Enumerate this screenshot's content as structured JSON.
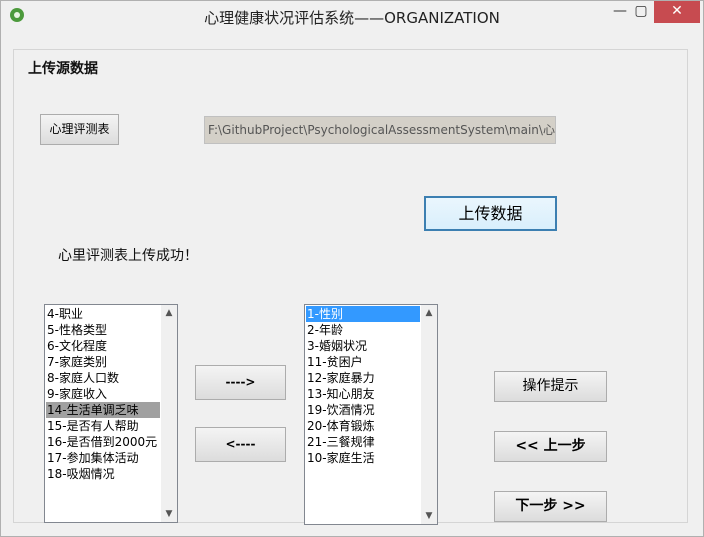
{
  "window": {
    "title": "心理健康状况评估系统——ORGANIZATION",
    "minimize_glyph": "—",
    "maximize_glyph": "▢",
    "close_glyph": "✕",
    "icon": "app-icon"
  },
  "group": {
    "title": "上传源数据"
  },
  "buttons": {
    "scale": "心理评测表",
    "upload": "上传数据",
    "move_right": "---->",
    "move_left": "<----",
    "hint": "操作提示",
    "prev": "<< 上一步",
    "next": "下一步 >>"
  },
  "path_field": {
    "value": "F:\\GithubProject\\PsychologicalAssessmentSystem\\main\\心理"
  },
  "status": {
    "message": "心里评测表上传成功！"
  },
  "left_list": {
    "items": [
      "4-职业",
      "5-性格类型",
      "6-文化程度",
      "7-家庭类别",
      "8-家庭人口数",
      "9-家庭收入",
      "14-生活单调乏味",
      "15-是否有人帮助",
      "16-是否借到2000元",
      "17-参加集体活动",
      "18-吸烟情况"
    ],
    "selected": "14-生活单调乏味"
  },
  "right_list": {
    "items": [
      "1-性别",
      "2-年龄",
      "3-婚姻状况",
      "11-贫困户",
      "12-家庭暴力",
      "13-知心朋友",
      "19-饮酒情况",
      "20-体育锻炼",
      "21-三餐规律",
      "10-家庭生活"
    ],
    "selected": "1-性别"
  },
  "scroll": {
    "up_glyph": "▲",
    "down_glyph": "▼"
  }
}
